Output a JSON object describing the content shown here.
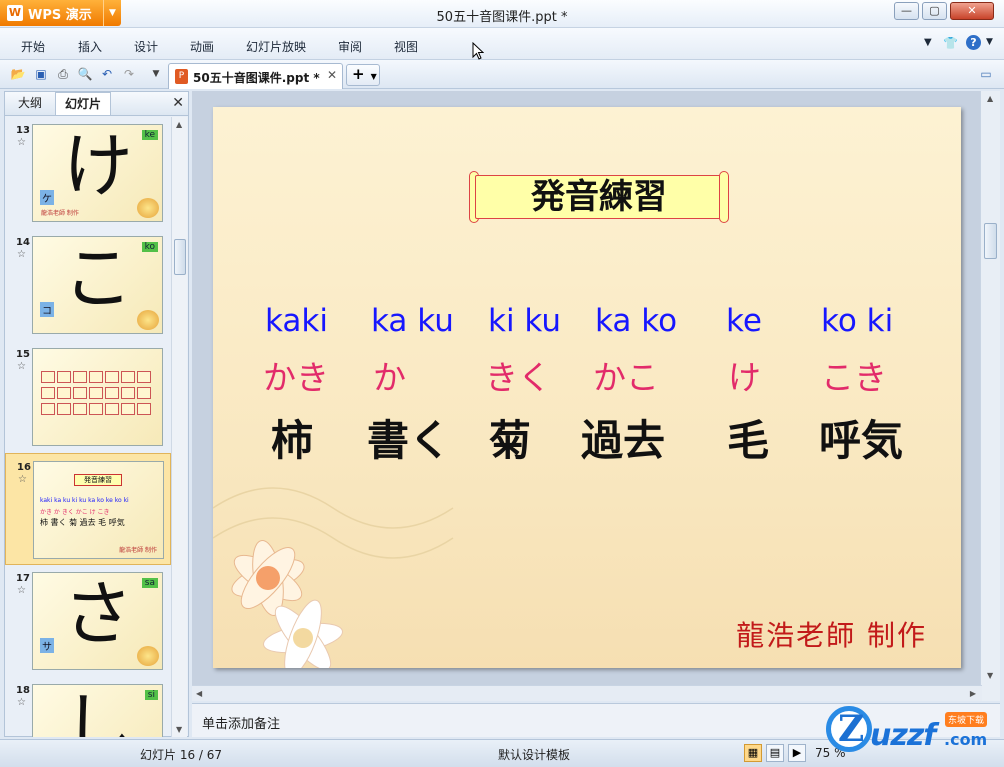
{
  "app": {
    "brand": "WPS 演示",
    "title": "50五十音图课件.ppt *"
  },
  "menu": [
    "开始",
    "插入",
    "设计",
    "动画",
    "幻灯片放映",
    "审阅",
    "视图"
  ],
  "tab": {
    "name": "50五十音图课件.ppt *",
    "new": "+"
  },
  "panel": {
    "tab_outline": "大纲",
    "tab_slides": "幻灯片"
  },
  "thumbnails": [
    {
      "num": "13",
      "kana": "け",
      "romaji": "ke",
      "katakana": "ケ",
      "sig": "龍浩老師 制作"
    },
    {
      "num": "14",
      "kana": "こ",
      "romaji": "ko",
      "katakana": "コ",
      "sig": ""
    },
    {
      "num": "15",
      "kana": "",
      "romaji": "",
      "katakana": "",
      "sig": ""
    },
    {
      "num": "16",
      "kana": "",
      "romaji": "",
      "katakana": "",
      "sig": "龍浩老師 制作",
      "mini_title": "発音練習",
      "mini_romaji": "kaki  ka ku  ki ku  ka ko  ke  ko ki",
      "mini_hira": "かき  か  きく  かこ  け  こき",
      "mini_kanji": "柿 書く 菊 過去 毛 呼気"
    },
    {
      "num": "17",
      "kana": "さ",
      "romaji": "sa",
      "katakana": "サ",
      "sig": ""
    },
    {
      "num": "18",
      "kana": "し",
      "romaji": "si",
      "katakana": "",
      "sig": ""
    }
  ],
  "slide": {
    "title": "発音練習",
    "romaji": [
      "kaki",
      "ka ku",
      "ki ku",
      "ka ko",
      "ke",
      "ko ki"
    ],
    "hiragana": [
      "かき",
      "か",
      "きく",
      "かこ",
      "け",
      "こき"
    ],
    "kanji": [
      "柿",
      "書く",
      "菊",
      "過去",
      "毛",
      "呼気"
    ],
    "signature": "龍浩老師 制作"
  },
  "notes": {
    "placeholder": "单击添加备注"
  },
  "status": {
    "slide": "幻灯片 16 / 67",
    "template": "默认设计模板",
    "zoom": "75 %"
  },
  "watermark": {
    "text": "uzzf",
    "suffix": ".com",
    "badge": "东坡下载"
  },
  "colors": {
    "romaji": "#1717ff",
    "hiragana": "#e22b6a",
    "signature": "#c21a1a",
    "accent": "#f07a00"
  }
}
